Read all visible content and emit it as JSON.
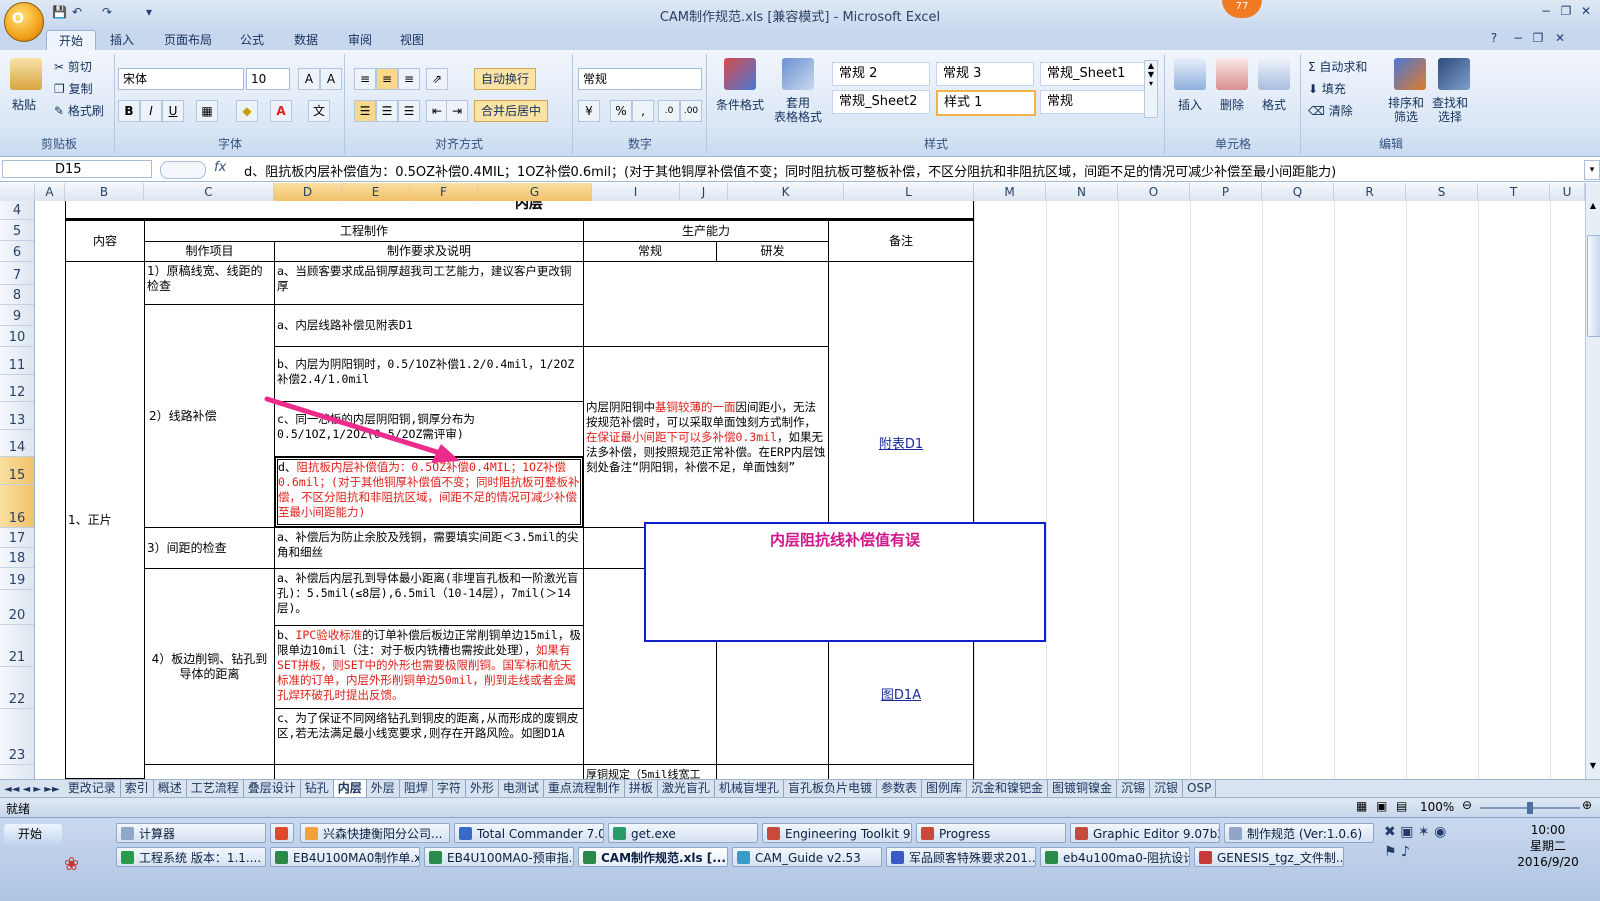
{
  "app": {
    "title": "CAM制作规范.xls  [兼容模式] - Microsoft Excel",
    "office_button": "O",
    "badge": "77"
  },
  "ribbon": {
    "tabs": [
      "开始",
      "插入",
      "页面布局",
      "公式",
      "数据",
      "审阅",
      "视图"
    ],
    "active_tab": "开始",
    "clipboard": {
      "paste": "粘贴",
      "cut": "剪切",
      "copy": "复制",
      "format_painter": "格式刷",
      "group": "剪贴板"
    },
    "font": {
      "name": "宋体",
      "size": "10",
      "bold": "B",
      "italic": "I",
      "underline": "U",
      "group": "字体"
    },
    "alignment": {
      "wrap": "自动换行",
      "merge": "合并后居中",
      "group": "对齐方式"
    },
    "number": {
      "format": "常规",
      "percent": "%",
      "comma": ",",
      "group": "数字"
    },
    "styles": {
      "cond_format": "条件格式",
      "table_format": "套用\n表格格式",
      "group": "样式",
      "cells": [
        "常规 2",
        "常规 3",
        "常规_Sheet1",
        "常规_Sheet2",
        "样式 1",
        "常规"
      ]
    },
    "cells": {
      "insert": "插入",
      "delete": "删除",
      "format": "格式",
      "group": "单元格"
    },
    "editing": {
      "autosum": "自动求和",
      "fill": "填充",
      "clear": "清除",
      "sort": "排序和\n筛选",
      "find": "查找和\n选择",
      "group": "编辑"
    }
  },
  "formula_bar": {
    "name_box": "D15",
    "fx": "fx",
    "content": "d、阻抗板内层补偿值为：0.5OZ补偿0.4MIL；1OZ补偿0.6mil；(对于其他铜厚补偿值不变；同时阻抗板可整板补偿，不区分阻抗和非阻抗区域，间距不足的情况可减少补偿至最小间距能力)"
  },
  "columns": [
    "A",
    "B",
    "C",
    "D",
    "E",
    "F",
    "G",
    "I",
    "J",
    "K",
    "L",
    "M",
    "N",
    "O",
    "P",
    "Q",
    "R",
    "S",
    "T",
    "U"
  ],
  "rows": [
    "4",
    "5",
    "6",
    "7",
    "8",
    "9",
    "10",
    "11",
    "12",
    "13",
    "14",
    "15",
    "16",
    "17",
    "18",
    "19",
    "20",
    "21",
    "22",
    "23"
  ],
  "sheet": {
    "top_partial": "内层",
    "h_content": "内容",
    "h_eng": "工程制作",
    "h_item": "制作项目",
    "h_req": "制作要求及说明",
    "h_cap": "生产能力",
    "h_normal": "常规",
    "h_rd": "研发",
    "h_note": "备注",
    "c_positive": "1、正片",
    "item1": "1）原稿线宽、线距的检查",
    "req1": "a、当顾客要求成品铜厚超我司工艺能力，建议客户更改铜厚",
    "item2": "2）线路补偿",
    "req2a": "a、内层线路补偿见附表D1",
    "req2b": "b、内层为阴阳铜时，0.5/1OZ补偿1.2/0.4mil，1/2OZ补偿2.4/1.0mil",
    "req2c": "c、同一芯板的内层阴阳铜,铜厚分布为0.5/1OZ,1/2OZ(0.5/2OZ需评审)",
    "req2d_prefix": "d、",
    "req2d_red": "阻抗板内层补偿值为：0.5OZ补偿0.4MIL；1OZ补偿0.6mil；(对于其他铜厚补偿值不变；同时阻抗板可整板补偿，不区分阻抗和非阻抗区域，间距不足的情况可减少补偿至最小间距能力)",
    "cap2_p1": "内层阴阳铜中",
    "cap2_red1": "基铜较薄的一面",
    "cap2_p2": "因间距小，无法按规范补偿时，可以采取单面蚀刻方式制作，",
    "cap2_red2": "在保证最小间距下可以多补偿0.3mil",
    "cap2_p3": "，如果无法多补偿，则按照规范正常补偿。在ERP内层蚀刻处备注“阴阳铜，补偿不足，单面蚀刻”",
    "note_link1": "附表D1",
    "item3": "3）间距的检查",
    "req3": "a、补偿后为防止余胶及残铜，需要填实间距＜3.5mil的尖角和细丝",
    "item4": "4）板边削铜、钻孔到导体的距离",
    "req4a": "a、补偿后内层孔到导体最小距离(非埋盲孔板和一阶激光盲孔)：5.5mil(≤8层),6.5mil（10-14层），7mil(＞14层)。",
    "req4b_p1": "b、",
    "req4b_red1": "IPC验收标准",
    "req4b_p2": "的订单补偿后板边正常削铜单边15mil，极限单边10mil（注：对于板内铣槽也需按此处理），",
    "req4b_red2": "如果有SET拼板，则SET中的外形也需要极限削铜。国军标和航天标准的订单，内层外形削铜单边50mil，削到走线或者金属孔焊环破孔时提出反馈。",
    "req4c": "c、为了保证不同网络钻孔到铜皮的距离,从而形成的废铜皮区,若无法满足最小线宽要求,则存在开路风险。如图D1A",
    "note_link2": "图D1A",
    "bottom_partial": "厚铜规定（5mil线宽工",
    "annotation": "内层阻抗线补偿值有误"
  },
  "sheet_tabs": [
    "更改记录",
    "索引",
    "概述",
    "工艺流程",
    "叠层设计",
    "钻孔",
    "内层",
    "外层",
    "阻焊",
    "字符",
    "外形",
    "电测试",
    "重点流程制作",
    "拼板",
    "激光盲孔",
    "机械盲埋孔",
    "盲孔板负片电镀",
    "参数表",
    "图例库",
    "沉金和镍钯金",
    "图镀铜镍金",
    "沉锡",
    "沉银",
    "OSP"
  ],
  "active_sheet": "内层",
  "status": {
    "ready": "就绪",
    "zoom": "100%"
  },
  "taskbar": {
    "start": "开始",
    "row1": [
      "计算器",
      "",
      "兴森快捷衡阳分公司...",
      "Total Commander 7.0 ...",
      "get.exe",
      "Engineering Toolkit 9.0...",
      "Progress",
      "Graphic Editor 9.07b2 ...",
      "制作规范 (Ver:1.0.6)"
    ],
    "row2": [
      "工程系统  版本：1.1....",
      "EB4U100MA0制作单.xl...",
      "EB4U100MA0-预审指...",
      "CAM制作规范.xls [...",
      "CAM_Guide v2.53",
      "军品顾客特殊要求201...",
      "eb4u100ma0-阻抗设计...",
      "GENESIS_tgz_文件制..."
    ],
    "active_task": "CAM制作规范.xls [...",
    "time": "10:00",
    "weekday": "星期二",
    "date": "2016/9/20"
  },
  "colors": {
    "accent_red": "#e0201a",
    "annotation_border": "#1020c8",
    "annotation_text": "#d0168a",
    "arrow": "#ec2b8c",
    "link": "#1a2c9a"
  }
}
